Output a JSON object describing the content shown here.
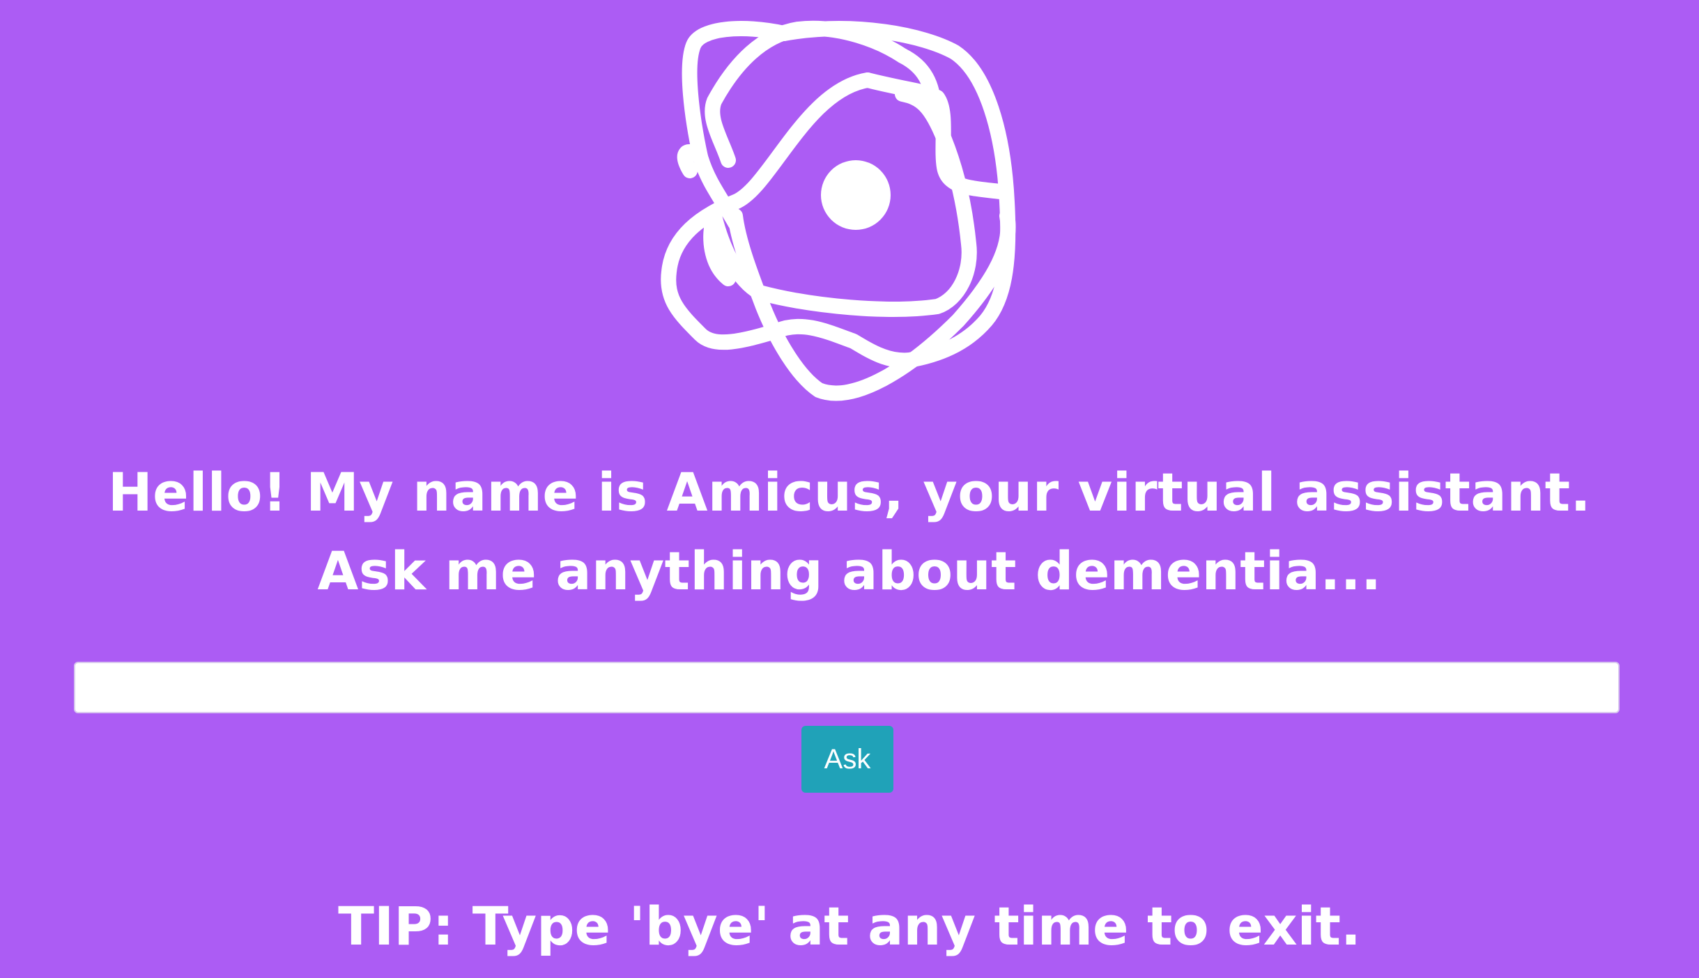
{
  "greeting": "Hello! My name is Amicus, your virtual assistant. Ask me anything about dementia...",
  "question": {
    "value": "",
    "placeholder": ""
  },
  "ask_label": "Ask",
  "tip": "TIP: Type 'bye' at any time to exit.",
  "logo_icon": "atom-orbit-logo-icon",
  "colors": {
    "background": "#ac5cf4",
    "button": "#20a2b8",
    "text": "#ffffff"
  }
}
